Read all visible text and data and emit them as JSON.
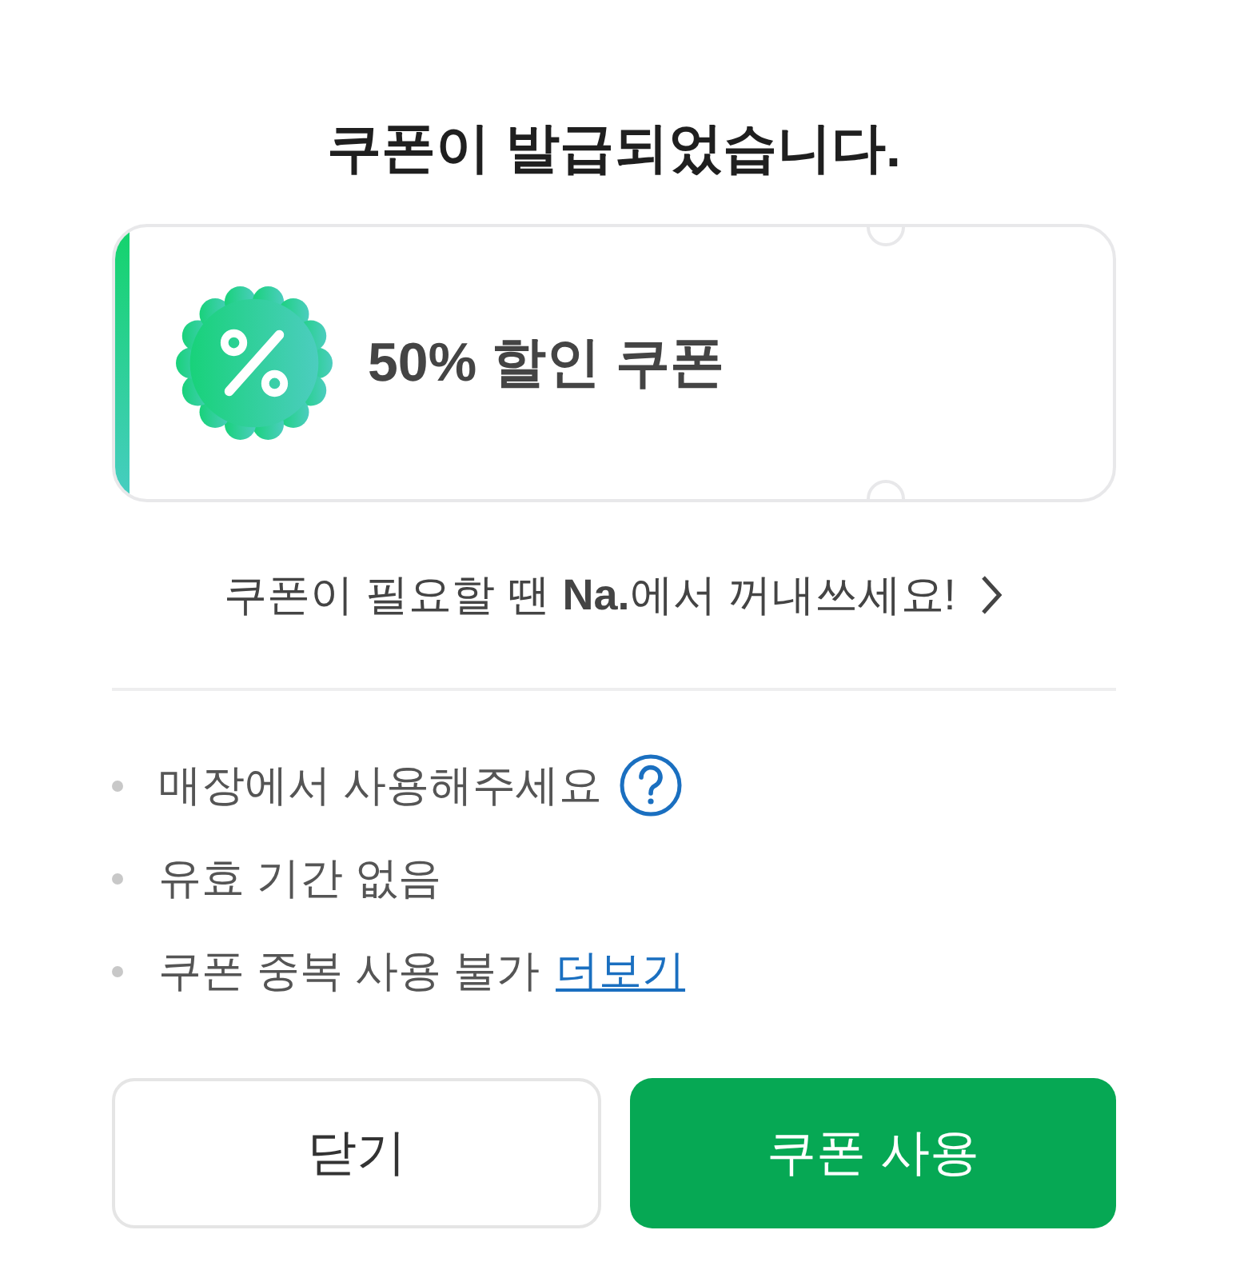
{
  "title": "쿠폰이 발급되었습니다.",
  "coupon": {
    "title": "50% 할인 쿠폰"
  },
  "wallet_link": {
    "text": "쿠폰이 필요할 땐 **Na.**에서 꺼내쓰세요!"
  },
  "notes": [
    {
      "kind": "help",
      "text": "매장에서 사용해주세요"
    },
    {
      "kind": "plain",
      "text": "유효 기간 없음"
    },
    {
      "kind": "link",
      "text": "쿠폰 중복 사용 불가",
      "link": "더보기"
    }
  ],
  "buttons": [
    {
      "kind": "secondary",
      "label": "닫기"
    },
    {
      "kind": "primary",
      "label": "쿠폰 사용"
    }
  ]
}
